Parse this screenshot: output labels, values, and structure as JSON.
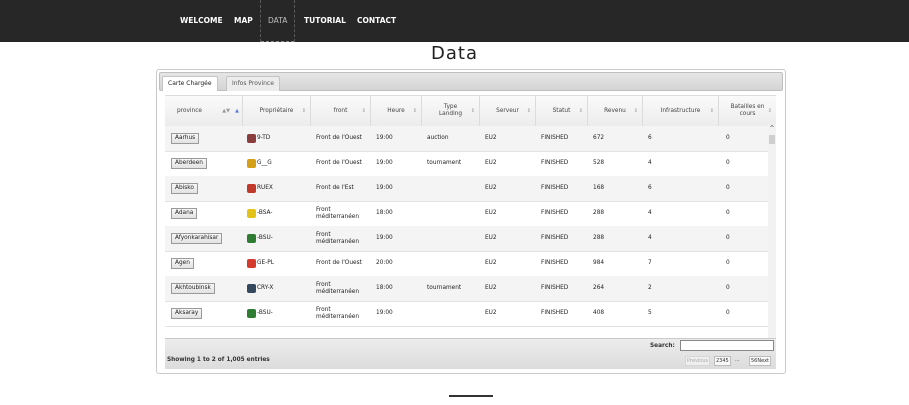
{
  "nav": {
    "items": [
      {
        "label": "WELCOME"
      },
      {
        "label": "MAP"
      },
      {
        "label": "DATA"
      },
      {
        "label": "TUTORIAL"
      },
      {
        "label": "CONTACT"
      }
    ],
    "active": "DATA"
  },
  "page": {
    "title": "Data"
  },
  "tabs": [
    {
      "label": "Carte Chargée",
      "active": true
    },
    {
      "label": "Infos Province",
      "active": false
    }
  ],
  "table": {
    "columns": [
      {
        "label": "province"
      },
      {
        "label": "Propriétaire"
      },
      {
        "label": "front"
      },
      {
        "label": "Heure"
      },
      {
        "label": "Type Landing"
      },
      {
        "label": "Serveur"
      },
      {
        "label": "Statut"
      },
      {
        "label": "Revenu"
      },
      {
        "label": "Infrastructure"
      },
      {
        "label": "Batailles en cours"
      }
    ],
    "rows": [
      {
        "province": "Aarhus",
        "owner": "9-TD",
        "owner_icon": "tank-icon",
        "front": "Front de l'Ouest",
        "time": "19:00",
        "landing": "auction",
        "server": "EU2",
        "status": "FINISHED",
        "revenue": "672",
        "infra": "6",
        "battles": "0"
      },
      {
        "province": "Aberdeen",
        "owner": "G__G",
        "owner_icon": "biohazard-icon",
        "front": "Front de l'Ouest",
        "time": "19:00",
        "landing": "tournament",
        "server": "EU2",
        "status": "FINISHED",
        "revenue": "528",
        "infra": "4",
        "battles": "0"
      },
      {
        "province": "Abisko",
        "owner": "RUEX",
        "owner_icon": "emblem-icon",
        "front": "Front de l'Est",
        "time": "19:00",
        "landing": "",
        "server": "EU2",
        "status": "FINISHED",
        "revenue": "168",
        "infra": "6",
        "battles": "0"
      },
      {
        "province": "Adana",
        "owner": "-BSA-",
        "owner_icon": "bird-icon",
        "front": "Front méditerranéen",
        "time": "18:00",
        "landing": "",
        "server": "EU2",
        "status": "FINISHED",
        "revenue": "288",
        "infra": "4",
        "battles": "0"
      },
      {
        "province": "Afyonkarahisar",
        "owner": "-BSU-",
        "owner_icon": "crocodile-icon",
        "front": "Front méditerranéen",
        "time": "19:00",
        "landing": "",
        "server": "EU2",
        "status": "FINISHED",
        "revenue": "288",
        "infra": "4",
        "battles": "0"
      },
      {
        "province": "Agen",
        "owner": "GE-PL",
        "owner_icon": "flame-icon",
        "front": "Front de l'Ouest",
        "time": "20:00",
        "landing": "",
        "server": "EU2",
        "status": "FINISHED",
        "revenue": "984",
        "infra": "7",
        "battles": "0"
      },
      {
        "province": "Akhtoubinsk",
        "owner": "CRY-X",
        "owner_icon": "shield-icon",
        "front": "Front méditerranéen",
        "time": "18:00",
        "landing": "tournament",
        "server": "EU2",
        "status": "FINISHED",
        "revenue": "264",
        "infra": "2",
        "battles": "0"
      },
      {
        "province": "Aksaray",
        "owner": "-BSU-",
        "owner_icon": "crocodile-icon",
        "front": "Front méditerranéen",
        "time": "19:00",
        "landing": "",
        "server": "EU2",
        "status": "FINISHED",
        "revenue": "408",
        "infra": "5",
        "battles": "0"
      }
    ]
  },
  "footer": {
    "info": "Showing 1 to 2 of 1,005 entries",
    "search_label": "Search:",
    "search_value": "",
    "pager": {
      "previous": "Previous",
      "page1": "2345",
      "ellipsis": "...",
      "next": "56Next"
    }
  },
  "colors": {
    "nav_bg": "#272727",
    "sort_active": "#5b7fd6"
  }
}
